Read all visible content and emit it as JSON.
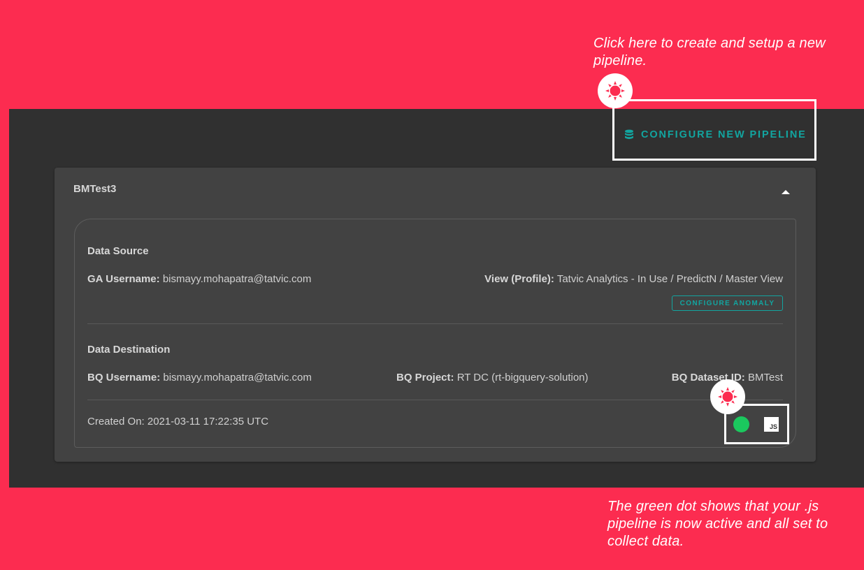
{
  "annotations": {
    "top": "Click here to create and setup a new pipeline.",
    "bottom": "The green dot shows that your .js pipeline is now active and all set to collect data."
  },
  "toolbar": {
    "configure_label": "CONFIGURE NEW PIPELINE",
    "configure_icon": "database-icon"
  },
  "pipeline": {
    "name": "BMTest3",
    "data_source": {
      "heading": "Data Source",
      "ga_username_label": "GA Username:",
      "ga_username": "bismayy.mohapatra@tatvic.com",
      "view_label": "View (Profile):",
      "view": "Tatvic Analytics - In Use / PredictN / Master View",
      "anomaly_button": "CONFIGURE ANOMALY"
    },
    "data_destination": {
      "heading": "Data Destination",
      "bq_username_label": "BQ Username:",
      "bq_username": "bismayy.mohapatra@tatvic.com",
      "bq_project_label": "BQ Project:",
      "bq_project": "RT DC (rt-bigquery-solution)",
      "bq_dataset_label": "BQ Dataset ID:",
      "bq_dataset": "BMTest"
    },
    "created_on": "Created On: 2021-03-11 17:22:35 UTC",
    "status": {
      "color": "#1bc85e",
      "badge": "JS"
    }
  },
  "colors": {
    "background": "#fc2c50",
    "app_bg": "#303030",
    "card_bg": "#424242",
    "accent": "#12a5a0"
  }
}
